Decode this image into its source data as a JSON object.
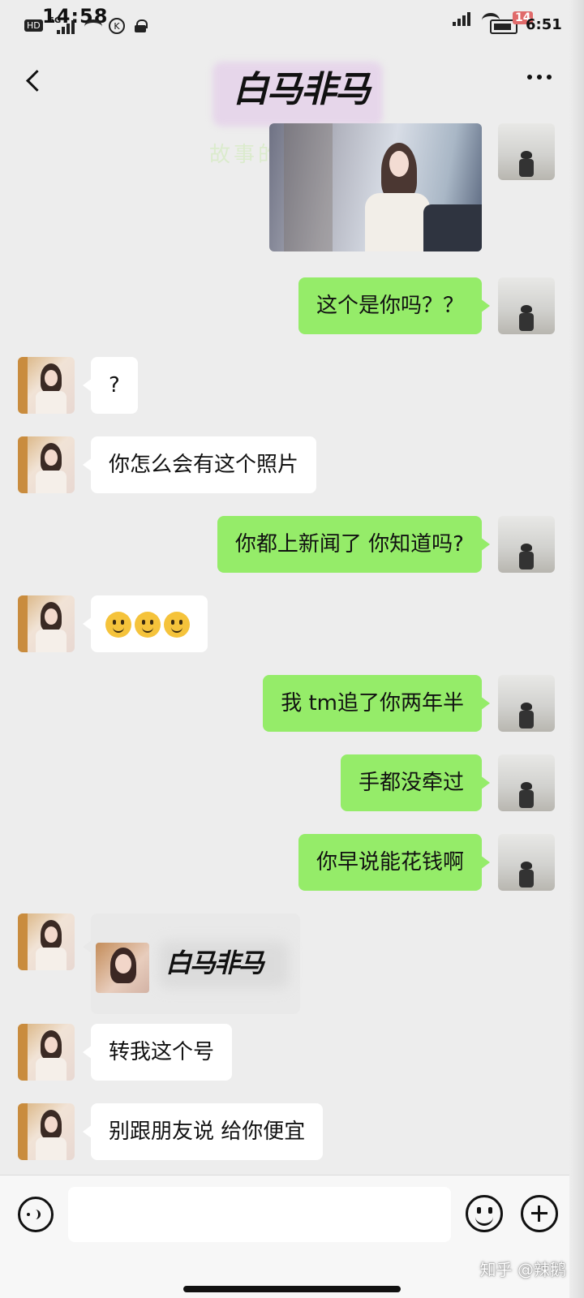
{
  "status_bar": {
    "clock_left": "14:58",
    "hd_label": "HD",
    "net_label": "5G",
    "k_label": "K",
    "battery_level": "14",
    "clock_right": "6:51"
  },
  "header": {
    "title": "白马非马",
    "back_icon": "chevron-left-icon",
    "more_icon": "more-dots-icon"
  },
  "watermark_top": "故事的小黄花",
  "messages": [
    {
      "side": "me",
      "type": "image",
      "text": ""
    },
    {
      "side": "me",
      "type": "text",
      "text": "这个是你吗？？"
    },
    {
      "side": "her",
      "type": "text",
      "text": "?"
    },
    {
      "side": "her",
      "type": "text",
      "text": "你怎么会有这个照片"
    },
    {
      "side": "me",
      "type": "text",
      "text": "你都上新闻了 你知道吗?"
    },
    {
      "side": "her",
      "type": "emoji",
      "text": "🙂🙂🙂"
    },
    {
      "side": "me",
      "type": "text",
      "text": "我 tm追了你两年半"
    },
    {
      "side": "me",
      "type": "text",
      "text": "手都没牵过"
    },
    {
      "side": "me",
      "type": "text",
      "text": "你早说能花钱啊"
    },
    {
      "side": "her",
      "type": "contact_card",
      "text": "白马非马"
    },
    {
      "side": "her",
      "type": "text",
      "text": "转我这个号"
    },
    {
      "side": "her",
      "type": "text",
      "text": "别跟朋友说 给你便宜"
    }
  ],
  "input_bar": {
    "placeholder": "",
    "voice_icon": "voice-icon",
    "emoji_icon": "emoji-icon",
    "plus_icon": "plus-icon"
  },
  "watermark_bottom": "知乎 @辣鹅",
  "colors": {
    "background": "#ededed",
    "my_bubble": "#95ec69",
    "her_bubble": "#ffffff"
  }
}
